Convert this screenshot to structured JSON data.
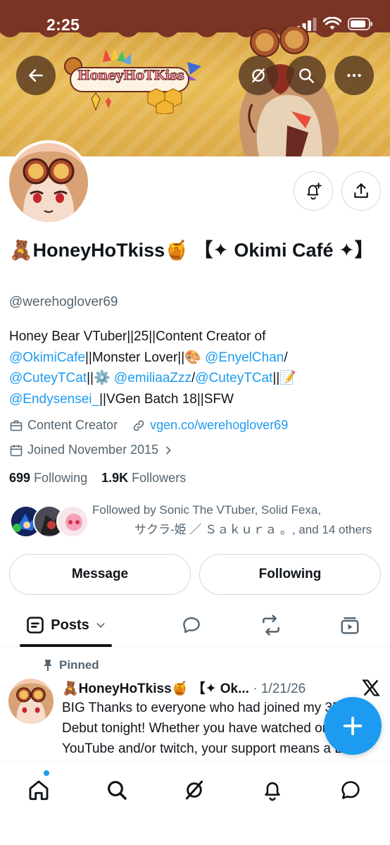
{
  "status_bar": {
    "time": "2:25"
  },
  "banner": {
    "logo_text": "HoneyHoTKiss"
  },
  "profile": {
    "display_name": "🧸HoneyHoTkiss🍯 【✦ Okimi Café ✦】",
    "handle": "@werehoglover69",
    "bio": {
      "line1": "Honey Bear VTuber||25||Content Creator of",
      "okimi_link": "@OkimiCafe",
      "mid1": "||Monster Lover||🎨 ",
      "enyel_link": "@EnyelChan",
      "slash1": "/",
      "cuteyt_link1": "@CuteyTCat",
      "mid2": "||⚙️ ",
      "emilia_link": "@emiliaaZzz",
      "slash2": "/",
      "cuteyt_link2": "@CuteyTCat",
      "mid3": "||📝",
      "endy_link": "@Endysensei_",
      "tail": "||VGen Batch 18||SFW"
    },
    "category": "Content Creator",
    "website": "vgen.co/werehoglover69",
    "joined": "Joined November 2015",
    "following_count": "699",
    "following_label": "Following",
    "followers_count": "1.9K",
    "followers_label": "Followers",
    "followed_by_line1": "Followed by Sonic The VTuber, Solid Fexa,",
    "followed_by_line2": "サクラ-姫 ／ Ｓａｋｕｒａ 。, and 14 others"
  },
  "actions": {
    "message": "Message",
    "following": "Following"
  },
  "tabs": {
    "posts": "Posts"
  },
  "pinned_post": {
    "pinned_label": "Pinned",
    "author": "🧸HoneyHoTkiss🍯 【✦ Ok...",
    "date": "· 1/21/26",
    "text": "BIG Thanks to everyone who had joined my 3D Debut tonight! Whether you have watched on YouTube and/or twitch, your support means a LOT!"
  },
  "colors": {
    "accent": "#1d9bf0",
    "banner_top": "#7a3424",
    "banner_gold": "#e2b450",
    "text_secondary": "#536471"
  },
  "icons": [
    "back-arrow-icon",
    "grok-icon",
    "search-icon",
    "more-icon",
    "bell-plus-icon",
    "share-icon",
    "briefcase-icon",
    "link-icon",
    "calendar-icon",
    "chevron-right-icon",
    "pin-icon",
    "x-logo-icon",
    "plus-icon",
    "home-icon",
    "explore-icon",
    "notifications-icon",
    "messages-icon"
  ]
}
